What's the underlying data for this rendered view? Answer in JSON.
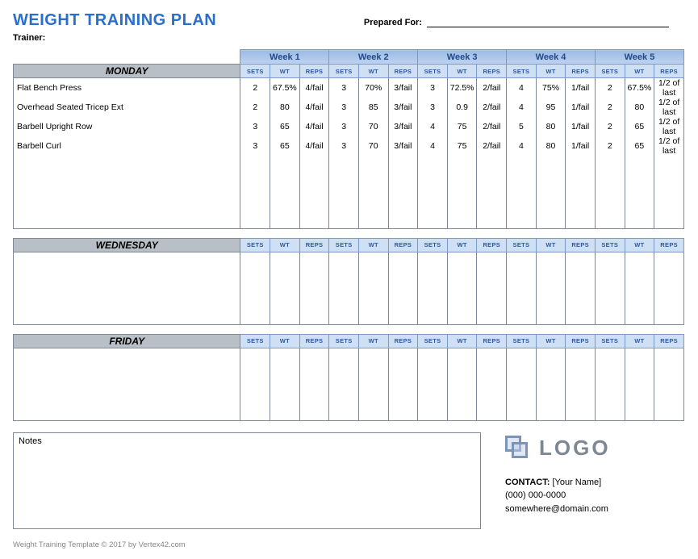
{
  "title": "WEIGHT TRAINING PLAN",
  "trainer_label": "Trainer:",
  "prepared_label": "Prepared For:",
  "weeks": [
    "Week 1",
    "Week 2",
    "Week 3",
    "Week 4",
    "Week 5"
  ],
  "col_headers": [
    "SETS",
    "WT",
    "REPS"
  ],
  "days": [
    {
      "name": "MONDAY",
      "exercises": [
        {
          "name": "Flat Bench Press",
          "weeks": [
            {
              "s": "2",
              "w": "67.5%",
              "r": "4/fail"
            },
            {
              "s": "3",
              "w": "70%",
              "r": "3/fail"
            },
            {
              "s": "3",
              "w": "72.5%",
              "r": "2/fail"
            },
            {
              "s": "4",
              "w": "75%",
              "r": "1/fail"
            },
            {
              "s": "2",
              "w": "67.5%",
              "r": "1/2 of last"
            }
          ]
        },
        {
          "name": "Overhead Seated Tricep Ext",
          "weeks": [
            {
              "s": "2",
              "w": "80",
              "r": "4/fail"
            },
            {
              "s": "3",
              "w": "85",
              "r": "3/fail"
            },
            {
              "s": "3",
              "w": "0.9",
              "r": "2/fail"
            },
            {
              "s": "4",
              "w": "95",
              "r": "1/fail"
            },
            {
              "s": "2",
              "w": "80",
              "r": "1/2 of last"
            }
          ]
        },
        {
          "name": "Barbell Upright Row",
          "weeks": [
            {
              "s": "3",
              "w": "65",
              "r": "4/fail"
            },
            {
              "s": "3",
              "w": "70",
              "r": "3/fail"
            },
            {
              "s": "4",
              "w": "75",
              "r": "2/fail"
            },
            {
              "s": "5",
              "w": "80",
              "r": "1/fail"
            },
            {
              "s": "2",
              "w": "65",
              "r": "1/2 of last"
            }
          ]
        },
        {
          "name": "Barbell Curl",
          "weeks": [
            {
              "s": "3",
              "w": "65",
              "r": "4/fail"
            },
            {
              "s": "3",
              "w": "70",
              "r": "3/fail"
            },
            {
              "s": "4",
              "w": "75",
              "r": "2/fail"
            },
            {
              "s": "4",
              "w": "80",
              "r": "1/fail"
            },
            {
              "s": "2",
              "w": "65",
              "r": "1/2 of last"
            }
          ]
        }
      ]
    },
    {
      "name": "WEDNESDAY",
      "exercises": []
    },
    {
      "name": "FRIDAY",
      "exercises": []
    }
  ],
  "notes_label": "Notes",
  "logo_text": "LOGO",
  "contact": {
    "label": "CONTACT:",
    "name": "[Your Name]",
    "phone": "(000) 000-0000",
    "email": "somewhere@domain.com"
  },
  "footer": "Weight Training Template © 2017 by Vertex42.com"
}
